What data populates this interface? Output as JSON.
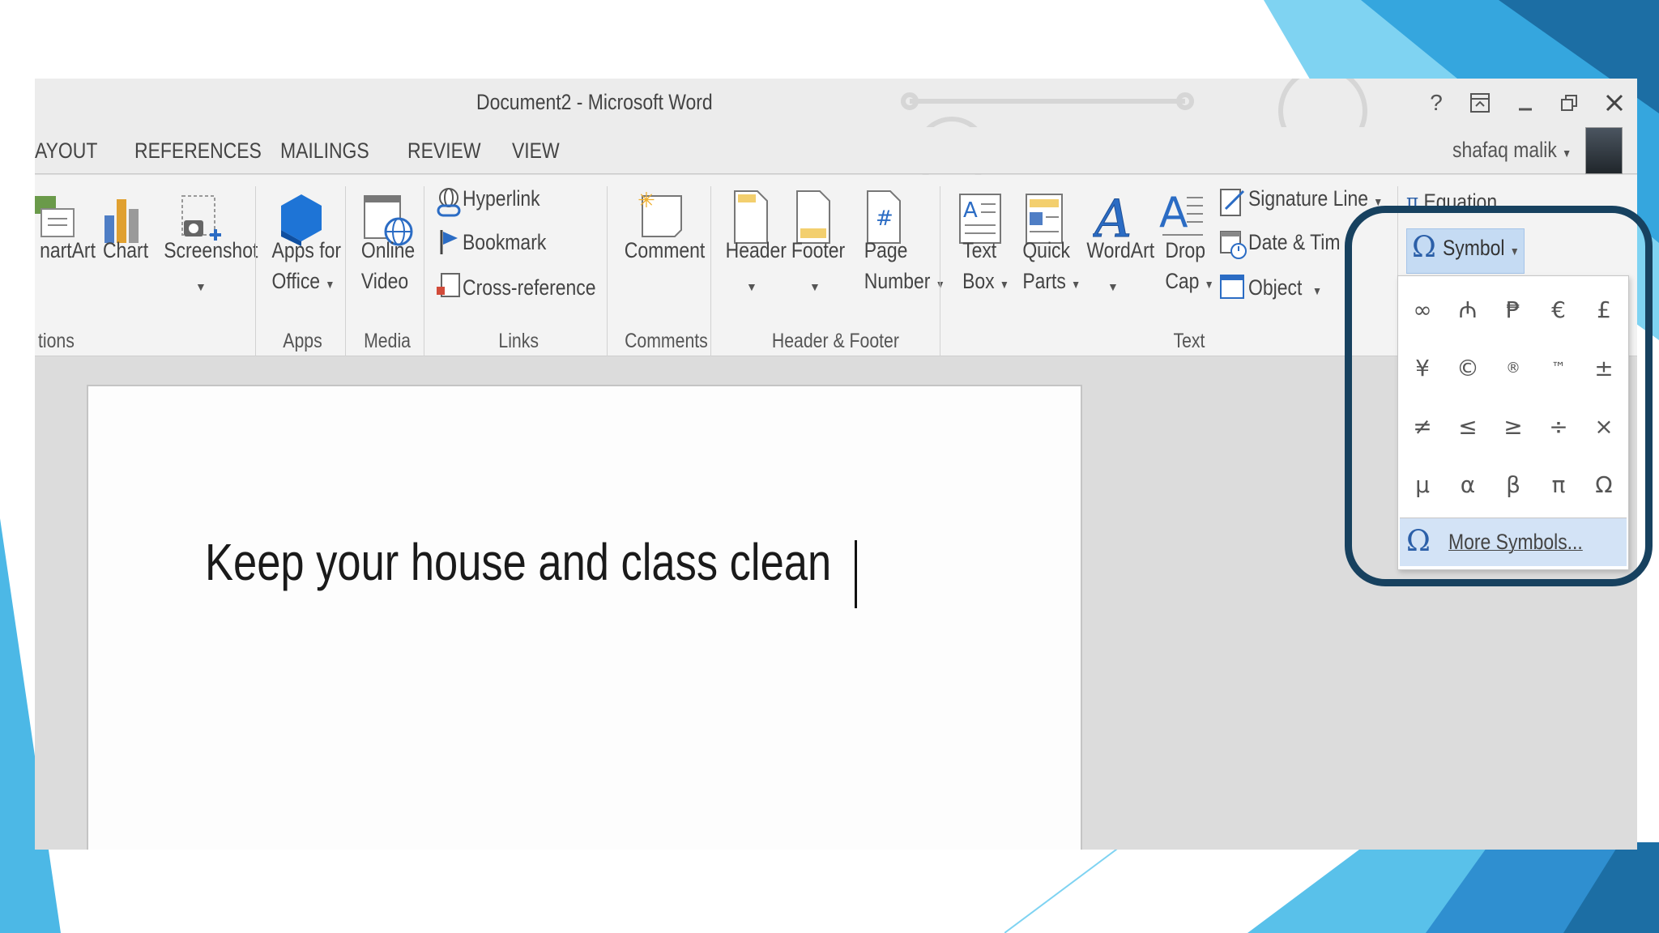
{
  "window": {
    "title": "Document2 - Microsoft Word",
    "controls": [
      "?",
      "⧉",
      "–",
      "🗗",
      "✕"
    ]
  },
  "tabs": [
    "AYOUT",
    "REFERENCES",
    "MAILINGS",
    "REVIEW",
    "VIEW"
  ],
  "user": {
    "name": "shafaq malik"
  },
  "ribbon": {
    "illustrations": {
      "smartart": "nartArt",
      "chart": "Chart",
      "screenshot": "Screenshot",
      "group": "tions"
    },
    "apps": {
      "line1": "Apps for",
      "line2": "Office",
      "group": "Apps"
    },
    "media": {
      "line1": "Online",
      "line2": "Video",
      "group": "Media"
    },
    "links": {
      "hyperlink": "Hyperlink",
      "bookmark": "Bookmark",
      "crossref": "Cross-reference",
      "group": "Links"
    },
    "comments": {
      "comment": "Comment",
      "group": "Comments"
    },
    "header_footer": {
      "header": "Header",
      "footer": "Footer",
      "page1": "Page",
      "page2": "Number",
      "group": "Header & Footer"
    },
    "text": {
      "textbox1": "Text",
      "textbox2": "Box",
      "quick1": "Quick",
      "quick2": "Parts",
      "wordart": "WordArt",
      "drop1": "Drop",
      "drop2": "Cap",
      "signature": "Signature Line",
      "datetime": "Date & Tim",
      "object": "Object",
      "group": "Text"
    },
    "symbols": {
      "equation": "Equation",
      "symbol": "Symbol"
    }
  },
  "document": {
    "text": "Keep your house and class clean"
  },
  "symbol_menu": {
    "grid": [
      "∞",
      "₼",
      "₱",
      "€",
      "£",
      "¥",
      "©",
      "®",
      "™",
      "±",
      "≠",
      "≤",
      "≥",
      "÷",
      "×",
      "µ",
      "α",
      "β",
      "π",
      "Ω"
    ],
    "more": "More Symbols..."
  },
  "colors": {
    "highlight_border": "#17415f",
    "accent_blue": "#2b5fa8",
    "slide_cyan": "#5ec8ee",
    "slide_blue": "#2f8fd0"
  }
}
